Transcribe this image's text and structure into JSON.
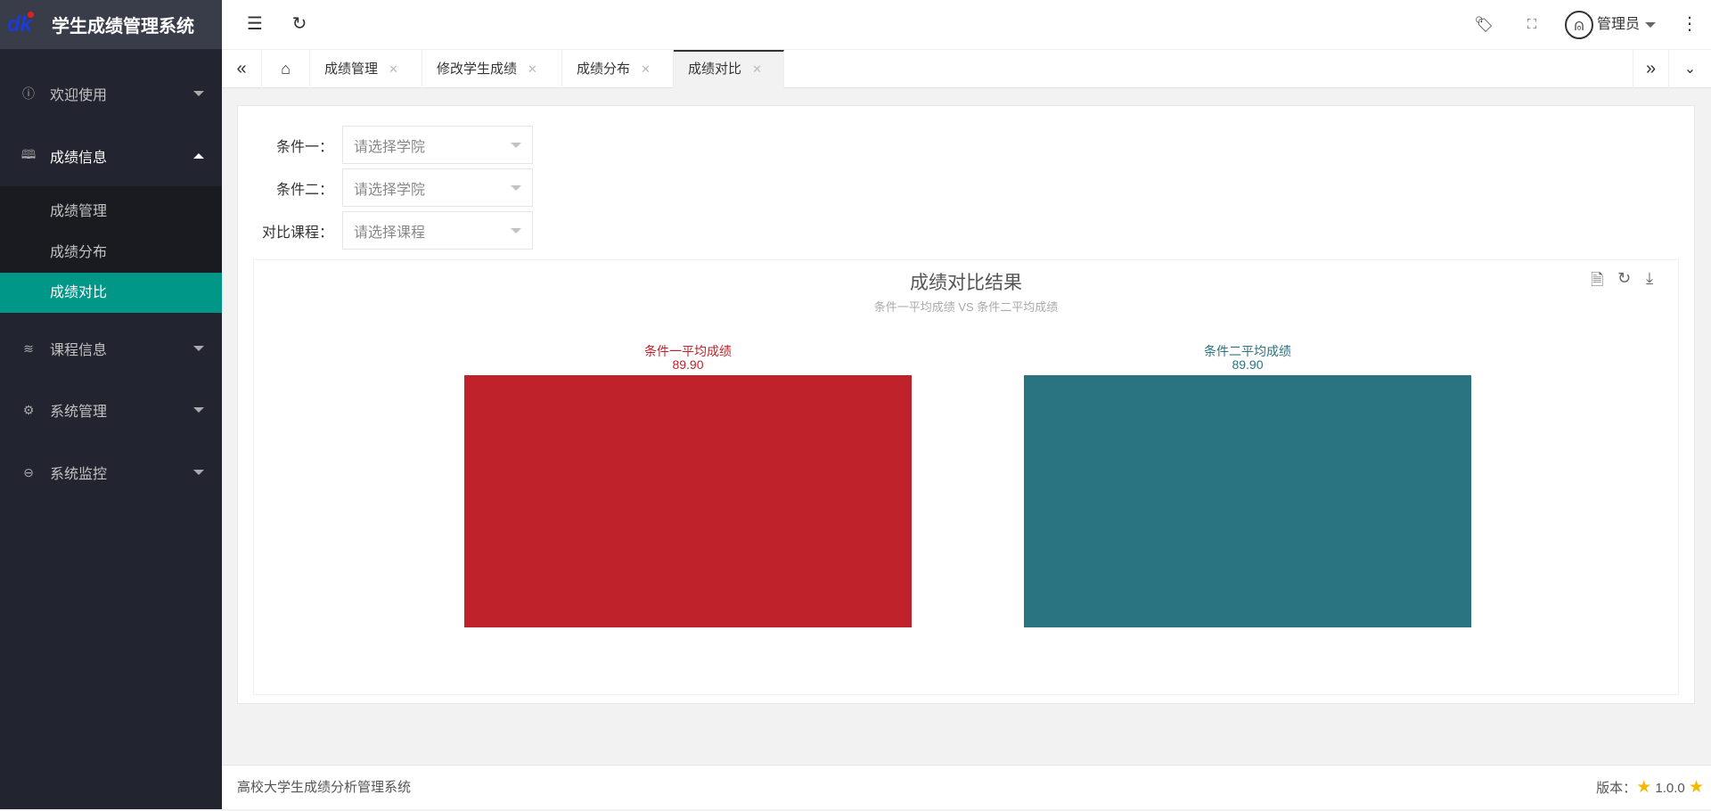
{
  "app": {
    "title": "学生成绩管理系统",
    "user": "管理员"
  },
  "sidebar": {
    "items": [
      {
        "label": "欢迎使用",
        "icon": "info-icon"
      },
      {
        "label": "成绩信息",
        "icon": "book-icon",
        "open": true,
        "children": [
          {
            "label": "成绩管理"
          },
          {
            "label": "成绩分布"
          },
          {
            "label": "成绩对比",
            "active": true
          }
        ]
      },
      {
        "label": "课程信息",
        "icon": "layers-icon"
      },
      {
        "label": "系统管理",
        "icon": "gear-icon"
      },
      {
        "label": "系统监控",
        "icon": "monitor-icon"
      }
    ]
  },
  "tabs": [
    {
      "label": "成绩管理"
    },
    {
      "label": "修改学生成绩"
    },
    {
      "label": "成绩分布"
    },
    {
      "label": "成绩对比",
      "active": true
    }
  ],
  "form": {
    "rows": [
      {
        "label": "条件一：",
        "placeholder": "请选择学院"
      },
      {
        "label": "条件二：",
        "placeholder": "请选择学院"
      },
      {
        "label": "对比课程：",
        "placeholder": "请选择课程"
      }
    ]
  },
  "chart_data": {
    "type": "bar",
    "title": "成绩对比结果",
    "subtitle": "条件一平均成绩 VS 条件二平均成绩",
    "categories": [
      "条件一平均成绩",
      "条件二平均成绩"
    ],
    "values": [
      89.9,
      89.9
    ],
    "value_labels": [
      "89.90",
      "89.90"
    ],
    "colors": [
      "#c0222b",
      "#297480"
    ],
    "ylim": [
      0,
      89.9
    ],
    "grid": false
  },
  "footer": {
    "text": "高校大学生成绩分析管理系统",
    "version_label": "版本：",
    "version": "1.0.0"
  },
  "colors": {
    "accent": "#009688",
    "sidebar": "#22252f"
  }
}
